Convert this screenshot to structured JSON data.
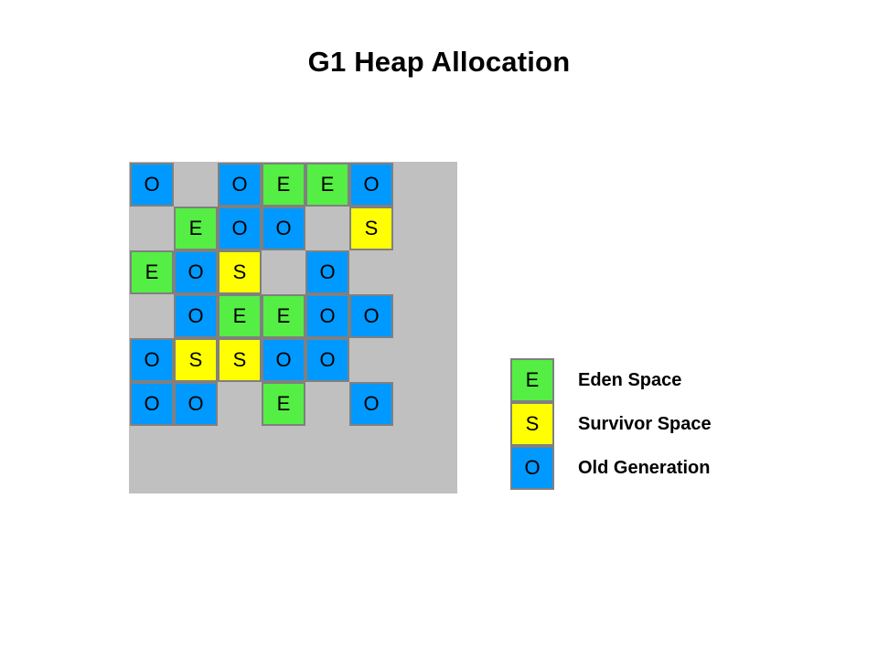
{
  "title": "G1 Heap Allocation",
  "colors": {
    "eden": "#55ee44",
    "survivor": "#ffff00",
    "old": "#0099ff",
    "panel_background": "#c0c0c0",
    "cell_border": "#808080",
    "page_background": "#ffffff",
    "text": "#000000"
  },
  "heap": {
    "rows": 6,
    "columns": 6,
    "cell_size_px": 48,
    "region_labels": {
      "E": "Eden Space",
      "S": "Survivor Space",
      "O": "Old Generation"
    },
    "grid": [
      [
        "O",
        "",
        "O",
        "E",
        "E",
        "O"
      ],
      [
        "",
        "E",
        "O",
        "O",
        "",
        "S"
      ],
      [
        "E",
        "O",
        "S",
        "",
        "O",
        ""
      ],
      [
        "",
        "O",
        "E",
        "E",
        "O",
        "O"
      ],
      [
        "O",
        "S",
        "S",
        "O",
        "O",
        ""
      ],
      [
        "O",
        "O",
        "",
        "E",
        "",
        "O"
      ]
    ]
  },
  "legend": {
    "items": [
      {
        "symbol": "E",
        "label": "Eden Space",
        "color": "#55ee44"
      },
      {
        "symbol": "S",
        "label": "Survivor Space",
        "color": "#ffff00"
      },
      {
        "symbol": "O",
        "label": "Old Generation",
        "color": "#0099ff"
      }
    ]
  }
}
